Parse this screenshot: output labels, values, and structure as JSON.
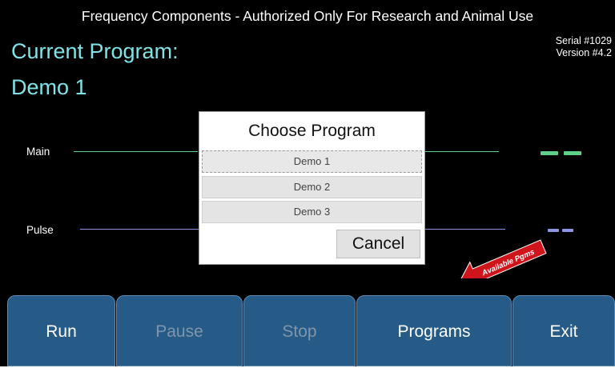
{
  "header": {
    "banner": "Frequency Components - Authorized Only For Research and Animal Use",
    "current_label": "Current Program:",
    "program_name": "Demo 1",
    "serial": "Serial #1029",
    "version": "Version #4.2"
  },
  "channels": [
    {
      "label": "Main",
      "color": "#5fd08a"
    },
    {
      "label": "Pulse",
      "color": "#8a94e0"
    }
  ],
  "dialog": {
    "title": "Choose Program",
    "options": [
      "Demo 1",
      "Demo 2",
      "Demo 3"
    ],
    "selected": "Demo 1",
    "cancel_label": "Cancel"
  },
  "hint": {
    "text": "Available Pgms",
    "icon": "arrow-icon",
    "color": "#d0141b"
  },
  "toolbar": {
    "run": "Run",
    "pause": "Pause",
    "stop": "Stop",
    "programs": "Programs",
    "exit": "Exit"
  },
  "colors": {
    "accent": "#7fe3e8",
    "button_bg": "#275b87"
  }
}
